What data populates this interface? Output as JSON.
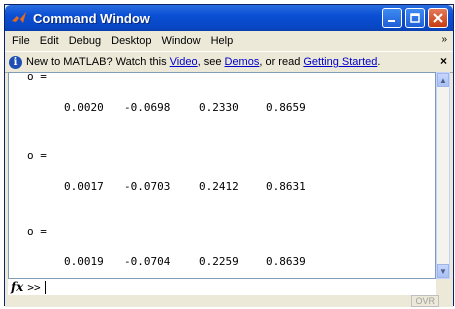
{
  "window": {
    "title": "Command Window"
  },
  "menu": {
    "items": [
      "File",
      "Edit",
      "Debug",
      "Desktop",
      "Window",
      "Help"
    ],
    "overflow_glyph": "»"
  },
  "infobar": {
    "prefix": "New to MATLAB? Watch this ",
    "video_link": "Video",
    "mid1": ", see ",
    "demos_link": "Demos",
    "mid2": ", or read ",
    "getting_started_link": "Getting Started",
    "suffix": ".",
    "close": "×"
  },
  "console": {
    "outputs": [
      {
        "label": "o =",
        "values": [
          "0.0020",
          "-0.0698",
          "0.2330",
          "0.8659"
        ]
      },
      {
        "label": "o =",
        "values": [
          "0.0017",
          "-0.0703",
          "0.2412",
          "0.8631"
        ]
      },
      {
        "label": "o =",
        "values": [
          "0.0019",
          "-0.0704",
          "0.2259",
          "0.8639"
        ]
      }
    ]
  },
  "prompt": {
    "fx": "fx",
    "symbol": ">>"
  },
  "status": {
    "ovr": "OVR"
  },
  "colors": {
    "titlebar": "#0a4fd4",
    "link": "#0000cc",
    "close_button": "#c63b12"
  }
}
